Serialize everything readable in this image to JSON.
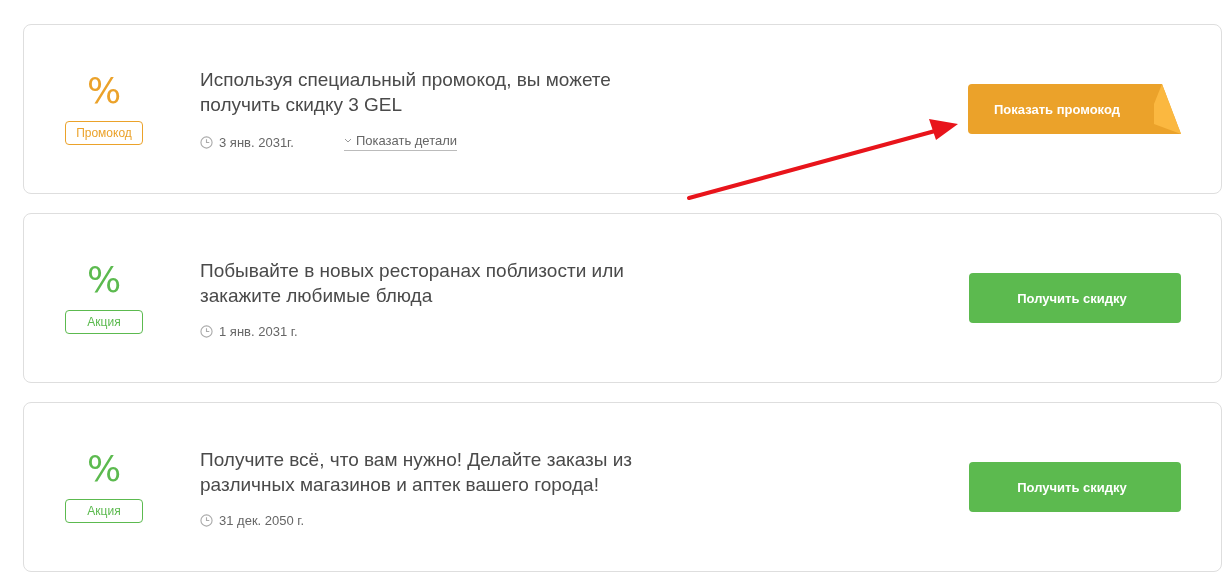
{
  "offers": [
    {
      "kind": "promo",
      "symbol": "%",
      "tag": "Промокод",
      "title": "Используя специальный промокод, вы можете получить скидку 3 GEL",
      "date": "3 янв. 2031г.",
      "details": "Показать детали",
      "button": "Показать промокод"
    },
    {
      "kind": "deal",
      "symbol": "%",
      "tag": "Акция",
      "title": "Побывайте в новых ресторанах поблизости или закажите любимые блюда",
      "date": "1 янв. 2031 г.",
      "button": "Получить скидку"
    },
    {
      "kind": "deal",
      "symbol": "%",
      "tag": "Акция",
      "title": "Получите всё, что вам нужно! Делайте заказы из различных магазинов и аптек вашего города!",
      "date": "31 дек. 2050 г.",
      "button": "Получить скидку"
    }
  ]
}
